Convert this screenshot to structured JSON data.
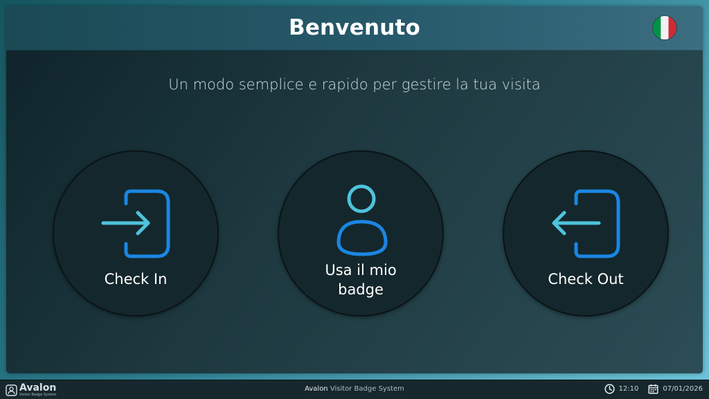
{
  "header": {
    "title": "Benvenuto",
    "language_flag": "italy-flag-icon"
  },
  "subtitle": "Un modo semplice e rapido per gestire la tua visita",
  "actions": [
    {
      "label": "Check In",
      "icon": "sign-in-icon"
    },
    {
      "label": "Usa il mio badge",
      "icon": "user-badge-icon"
    },
    {
      "label": "Check Out",
      "icon": "sign-out-icon"
    }
  ],
  "footer": {
    "logo_name": "Avalon",
    "logo_tagline": "Visitor Badge System",
    "app_brand": "Avalon",
    "app_name": "Visitor Badge System",
    "time": "12:10",
    "date": "07/01/2026"
  },
  "colors": {
    "icon_blue": "#1a86e2",
    "icon_cyan": "#4fc3dc",
    "flag_green": "#009246",
    "flag_white": "#f1f2f1",
    "flag_red": "#ce2b37"
  }
}
